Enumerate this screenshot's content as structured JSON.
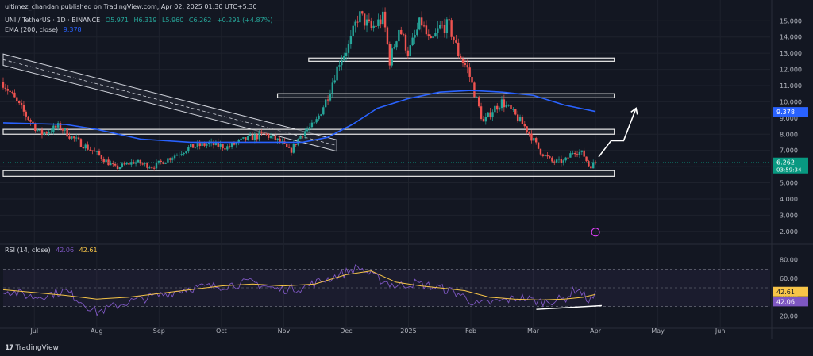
{
  "publisher": "ultimez_chandan published on TradingView.com, Apr 02, 2025 01:30 UTC+5:30",
  "symbol": "UNI / TetherUS · 1D · BINANCE",
  "ohlc": {
    "o": "O5.971",
    "h": "H6.319",
    "l": "L5.960",
    "c": "C6.262",
    "chg": "+0.291 (+4.87%)"
  },
  "ema_label": "EMA (200, close)",
  "ema_value": "9.378",
  "rsi_label": "RSI (14, close)",
  "rsi_value": "42.06",
  "rsi_ma_value": "42.61",
  "last_price": "6.262",
  "countdown": "03:59:34",
  "brand": "TradingView",
  "colors": {
    "up": "#26a69a",
    "down": "#ef5350",
    "ema": "#2962ff",
    "rsi": "#7e57c2",
    "rsi_ma": "#f7c548",
    "price_tag": "#089981",
    "ema_tag": "#2962ff"
  },
  "chart_data": {
    "type": "candlestick",
    "price_axis": {
      "ticks": [
        "15.000",
        "14.000",
        "13.000",
        "12.000",
        "11.000",
        "10.000",
        "9.000",
        "8.000",
        "7.000",
        "6.000",
        "5.000",
        "4.000",
        "3.000",
        "2.000"
      ],
      "values": [
        15,
        14,
        13,
        12,
        11,
        10,
        9,
        8,
        7,
        6,
        5,
        4,
        3,
        2
      ],
      "ylim": [
        1.5,
        15.7
      ]
    },
    "rsi_axis": {
      "ticks": [
        "80.00",
        "60.00",
        "40.00",
        "20.00"
      ],
      "values": [
        80,
        60,
        40,
        20
      ],
      "ylim": [
        12,
        88
      ],
      "upper": 70,
      "lower": 30
    },
    "time_axis": {
      "labels": [
        "Jul",
        "Aug",
        "Sep",
        "Oct",
        "Nov",
        "Dec",
        "2025",
        "Feb",
        "Mar",
        "Apr",
        "May",
        "Jun"
      ],
      "positions": [
        0.5,
        1.5,
        2.5,
        3.5,
        4.5,
        5.5,
        6.5,
        7.5,
        8.5,
        9.5,
        10.5,
        11.5
      ]
    },
    "price_path": [
      [
        0,
        11.2
      ],
      [
        0.3,
        9.5
      ],
      [
        0.6,
        8.0
      ],
      [
        0.9,
        8.5
      ],
      [
        1.1,
        7.8
      ],
      [
        1.5,
        6.8
      ],
      [
        1.8,
        5.9
      ],
      [
        2.1,
        6.3
      ],
      [
        2.4,
        6.0
      ],
      [
        2.7,
        6.6
      ],
      [
        3.0,
        7.2
      ],
      [
        3.3,
        7.4
      ],
      [
        3.6,
        7.2
      ],
      [
        3.9,
        7.7
      ],
      [
        4.2,
        8.0
      ],
      [
        4.45,
        7.5
      ],
      [
        4.6,
        6.9
      ],
      [
        4.8,
        8.1
      ],
      [
        5.0,
        8.6
      ],
      [
        5.2,
        10.3
      ],
      [
        5.4,
        12.6
      ],
      [
        5.55,
        13.5
      ],
      [
        5.7,
        15.4
      ],
      [
        5.9,
        14.5
      ],
      [
        6.1,
        15.2
      ],
      [
        6.2,
        12.5
      ],
      [
        6.35,
        14.6
      ],
      [
        6.5,
        13.0
      ],
      [
        6.7,
        15.0
      ],
      [
        6.85,
        13.5
      ],
      [
        7.0,
        14.6
      ],
      [
        7.15,
        14.7
      ],
      [
        7.3,
        13.0
      ],
      [
        7.45,
        12.0
      ],
      [
        7.6,
        10.0
      ],
      [
        7.7,
        8.7
      ],
      [
        7.85,
        9.5
      ],
      [
        8.0,
        10.0
      ],
      [
        8.2,
        9.2
      ],
      [
        8.4,
        8.3
      ],
      [
        8.6,
        7.0
      ],
      [
        8.8,
        6.3
      ],
      [
        9.0,
        6.3
      ],
      [
        9.15,
        7.0
      ],
      [
        9.3,
        6.8
      ],
      [
        9.4,
        6.0
      ],
      [
        9.5,
        6.26
      ]
    ],
    "ema_path": [
      [
        0,
        8.7
      ],
      [
        1,
        8.6
      ],
      [
        1.5,
        8.3
      ],
      [
        2.2,
        7.7
      ],
      [
        3.0,
        7.5
      ],
      [
        4.0,
        7.5
      ],
      [
        4.8,
        7.5
      ],
      [
        5.2,
        7.8
      ],
      [
        5.6,
        8.6
      ],
      [
        6.0,
        9.6
      ],
      [
        6.5,
        10.2
      ],
      [
        7.0,
        10.6
      ],
      [
        7.5,
        10.7
      ],
      [
        8.0,
        10.6
      ],
      [
        8.5,
        10.4
      ],
      [
        9.0,
        9.8
      ],
      [
        9.5,
        9.4
      ]
    ],
    "rsi_path": [
      [
        0,
        48
      ],
      [
        0.5,
        40
      ],
      [
        1.0,
        47
      ],
      [
        1.5,
        24
      ],
      [
        2.0,
        35
      ],
      [
        2.5,
        42
      ],
      [
        3.0,
        50
      ],
      [
        3.5,
        52
      ],
      [
        4.0,
        56
      ],
      [
        4.4,
        48
      ],
      [
        4.8,
        50
      ],
      [
        5.0,
        55
      ],
      [
        5.4,
        64
      ],
      [
        5.7,
        72
      ],
      [
        6.0,
        60
      ],
      [
        6.3,
        52
      ],
      [
        6.6,
        55
      ],
      [
        7.0,
        50
      ],
      [
        7.3,
        44
      ],
      [
        7.6,
        32
      ],
      [
        8.0,
        36
      ],
      [
        8.3,
        40
      ],
      [
        8.6,
        35
      ],
      [
        9.0,
        38
      ],
      [
        9.2,
        50
      ],
      [
        9.4,
        36
      ],
      [
        9.5,
        42
      ]
    ],
    "rsi_ma_path": [
      [
        0,
        48
      ],
      [
        0.5,
        45
      ],
      [
        1.0,
        42
      ],
      [
        1.5,
        38
      ],
      [
        2.0,
        40
      ],
      [
        2.5,
        44
      ],
      [
        3.0,
        48
      ],
      [
        3.5,
        52
      ],
      [
        4.0,
        54
      ],
      [
        4.5,
        52
      ],
      [
        5.0,
        54
      ],
      [
        5.5,
        64
      ],
      [
        5.9,
        68
      ],
      [
        6.3,
        56
      ],
      [
        6.7,
        52
      ],
      [
        7.0,
        50
      ],
      [
        7.4,
        47
      ],
      [
        7.8,
        40
      ],
      [
        8.2,
        38
      ],
      [
        8.6,
        37
      ],
      [
        9.0,
        38
      ],
      [
        9.3,
        40
      ],
      [
        9.5,
        43
      ]
    ],
    "support_zones": [
      {
        "from": [
          0,
          5.4
        ],
        "to": [
          9.8,
          5.75
        ]
      },
      {
        "from": [
          0,
          8.0
        ],
        "to": [
          9.8,
          8.3
        ]
      },
      {
        "from": [
          4.4,
          10.25
        ],
        "to": [
          9.8,
          10.5
        ]
      },
      {
        "from": [
          4.9,
          12.5
        ],
        "to": [
          9.8,
          12.7
        ]
      }
    ],
    "trend_channel": {
      "from": [
        0,
        12.6
      ],
      "to": [
        5.35,
        7.3
      ],
      "width": 0.35
    },
    "arrow_projection": [
      [
        9.55,
        6.6
      ],
      [
        9.75,
        7.6
      ],
      [
        9.95,
        7.6
      ],
      [
        10.15,
        9.6
      ]
    ],
    "rsi_trendline": [
      [
        8.55,
        27
      ],
      [
        9.6,
        31
      ]
    ]
  }
}
